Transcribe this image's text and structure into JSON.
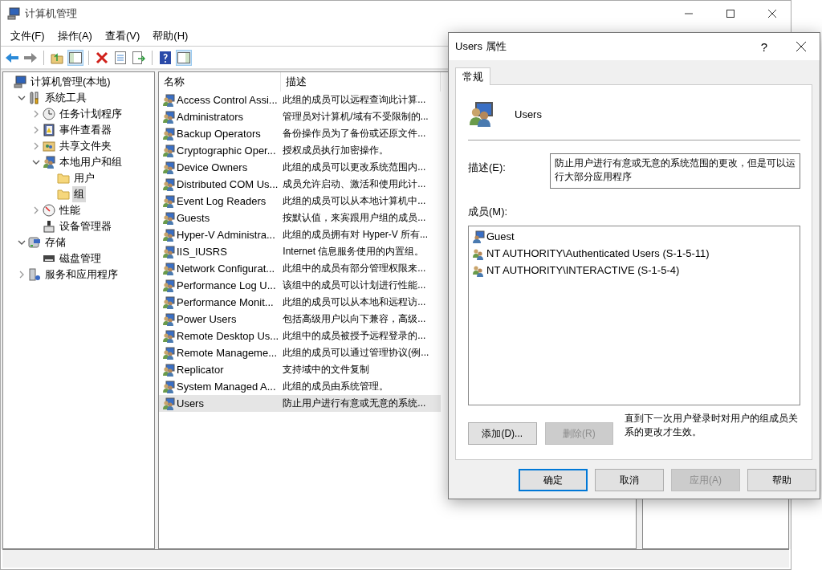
{
  "window": {
    "title": "计算机管理"
  },
  "menu": [
    "文件(F)",
    "操作(A)",
    "查看(V)",
    "帮助(H)"
  ],
  "tree": [
    {
      "label": "计算机管理(本地)",
      "kind": "computer",
      "selected": false,
      "children": [
        {
          "label": "系统工具",
          "kind": "tools",
          "expanded": true,
          "selected": false,
          "children": [
            {
              "label": "任务计划程序",
              "kind": "clock",
              "expanded": false,
              "selected": false
            },
            {
              "label": "事件查看器",
              "kind": "event",
              "expanded": false,
              "selected": false
            },
            {
              "label": "共享文件夹",
              "kind": "share",
              "expanded": false,
              "selected": false
            },
            {
              "label": "本地用户和组",
              "kind": "users",
              "expanded": true,
              "selected": false,
              "children": [
                {
                  "label": "用户",
                  "kind": "folder",
                  "selected": false
                },
                {
                  "label": "组",
                  "kind": "folder",
                  "selected": true
                }
              ]
            },
            {
              "label": "性能",
              "kind": "perf",
              "expanded": false,
              "selected": false
            },
            {
              "label": "设备管理器",
              "kind": "device",
              "selected": false
            }
          ]
        },
        {
          "label": "存储",
          "kind": "storage",
          "expanded": true,
          "selected": false,
          "children": [
            {
              "label": "磁盘管理",
              "kind": "disk",
              "selected": false
            }
          ]
        },
        {
          "label": "服务和应用程序",
          "kind": "services",
          "expanded": false,
          "selected": false
        }
      ]
    }
  ],
  "table": {
    "columns": [
      "名称",
      "描述"
    ],
    "rows": [
      {
        "name": "Access Control Assi...",
        "description": "此组的成员可以远程查询此计算...",
        "selected": false
      },
      {
        "name": "Administrators",
        "description": "管理员对计算机/域有不受限制的...",
        "selected": false
      },
      {
        "name": "Backup Operators",
        "description": "备份操作员为了备份或还原文件...",
        "selected": false
      },
      {
        "name": "Cryptographic Oper...",
        "description": "授权成员执行加密操作。",
        "selected": false
      },
      {
        "name": "Device Owners",
        "description": "此组的成员可以更改系统范围内...",
        "selected": false
      },
      {
        "name": "Distributed COM Us...",
        "description": "成员允许启动、激活和使用此计...",
        "selected": false
      },
      {
        "name": "Event Log Readers",
        "description": "此组的成员可以从本地计算机中...",
        "selected": false
      },
      {
        "name": "Guests",
        "description": "按默认值，来宾跟用户组的成员...",
        "selected": false
      },
      {
        "name": "Hyper-V Administra...",
        "description": "此组的成员拥有对 Hyper-V 所有...",
        "selected": false
      },
      {
        "name": "IIS_IUSRS",
        "description": "Internet 信息服务使用的内置组。",
        "selected": false
      },
      {
        "name": "Network Configurat...",
        "description": "此组中的成员有部分管理权限来...",
        "selected": false
      },
      {
        "name": "Performance Log U...",
        "description": "该组中的成员可以计划进行性能...",
        "selected": false
      },
      {
        "name": "Performance Monit...",
        "description": "此组的成员可以从本地和远程访...",
        "selected": false
      },
      {
        "name": "Power Users",
        "description": "包括高级用户以向下兼容，高级...",
        "selected": false
      },
      {
        "name": "Remote Desktop Us...",
        "description": "此组中的成员被授予远程登录的...",
        "selected": false
      },
      {
        "name": "Remote Manageme...",
        "description": "此组的成员可以通过管理协议(例...",
        "selected": false
      },
      {
        "name": "Replicator",
        "description": "支持域中的文件复制",
        "selected": false
      },
      {
        "name": "System Managed A...",
        "description": "此组的成员由系统管理。",
        "selected": false
      },
      {
        "name": "Users",
        "description": "防止用户进行有意或无意的系统...",
        "selected": true
      }
    ]
  },
  "dialog": {
    "title": "Users 属性",
    "help_glyph": "?",
    "tabs": [
      {
        "label": "常规",
        "selected": true
      }
    ],
    "group_name": "Users",
    "description_label": "描述(E):",
    "description": "防止用户进行有意或无意的系统范围的更改，但是可以运行大部分应用程序",
    "members_label": "成员(M):",
    "members": [
      {
        "name": "Guest",
        "kind": "user"
      },
      {
        "name": "NT AUTHORITY\\Authenticated Users (S-1-5-11)",
        "kind": "group"
      },
      {
        "name": "NT AUTHORITY\\INTERACTIVE (S-1-5-4)",
        "kind": "group"
      }
    ],
    "member_buttons": [
      {
        "label": "添加(D)...",
        "disabled": false
      },
      {
        "label": "删除(R)",
        "disabled": true
      }
    ],
    "note": "直到下一次用户登录时对用户的组成员关系的更改才生效。",
    "buttons": [
      {
        "label": "确定",
        "disabled": false,
        "default": true
      },
      {
        "label": "取消",
        "disabled": false,
        "default": false
      },
      {
        "label": "应用(A)",
        "disabled": true,
        "default": false
      },
      {
        "label": "帮助",
        "disabled": false,
        "default": false
      }
    ]
  }
}
